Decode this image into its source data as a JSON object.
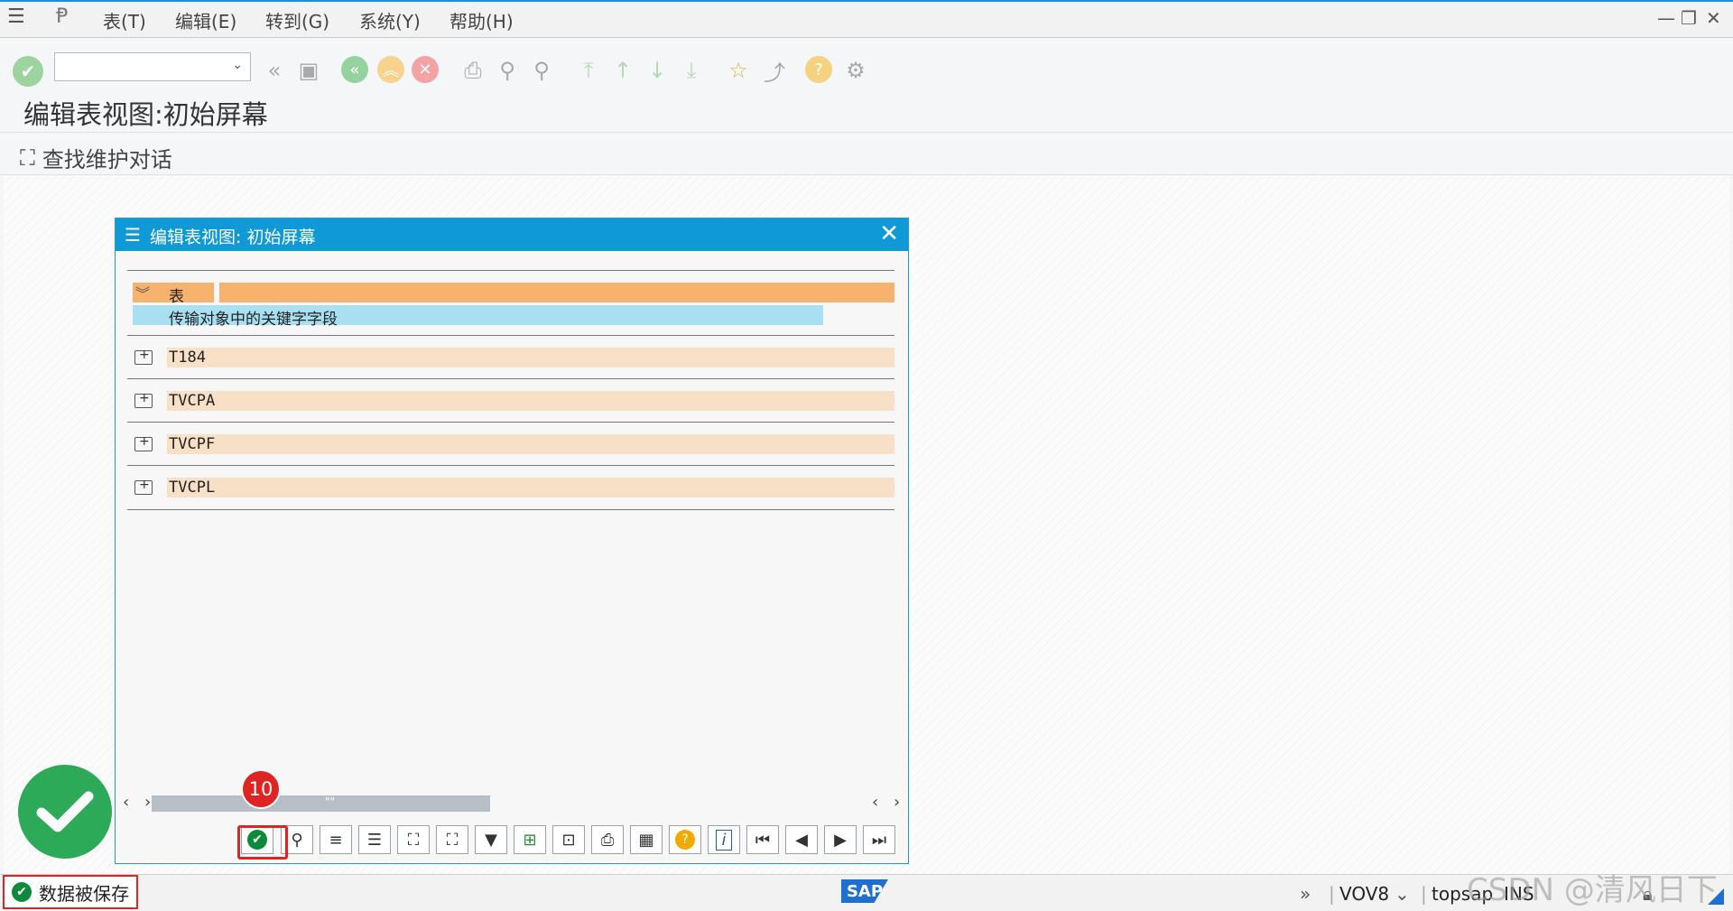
{
  "menubar": {
    "items": [
      "表(T)",
      "编辑(E)",
      "转到(G)",
      "系统(Y)",
      "帮助(H)"
    ]
  },
  "page": {
    "title": "编辑表视图:初始屏幕",
    "find_label": "查找维护对话"
  },
  "dialog": {
    "title": "编辑表视图: 初始屏幕",
    "root_label": "表",
    "root_description": "传输对象中的关键字字段",
    "tables": [
      "T184",
      "TVCPA",
      "TVCPF",
      "TVCPL"
    ],
    "scroll_indicator": "\"\""
  },
  "annotations": {
    "step_number": "10"
  },
  "statusbar": {
    "message": "数据被保存",
    "sap_logo": "SAP",
    "transaction": "VOV8",
    "user": "topsap",
    "mode": "INS"
  },
  "watermark": "CSDN @清风日下",
  "colors": {
    "dialog_title_bg": "#0f9ad7",
    "root_bar": "#f6b36d",
    "desc_bar": "#a8e0f2",
    "row_bar": "#f8e0c7",
    "success_green": "#2daa57",
    "highlight_red": "#e02424"
  }
}
